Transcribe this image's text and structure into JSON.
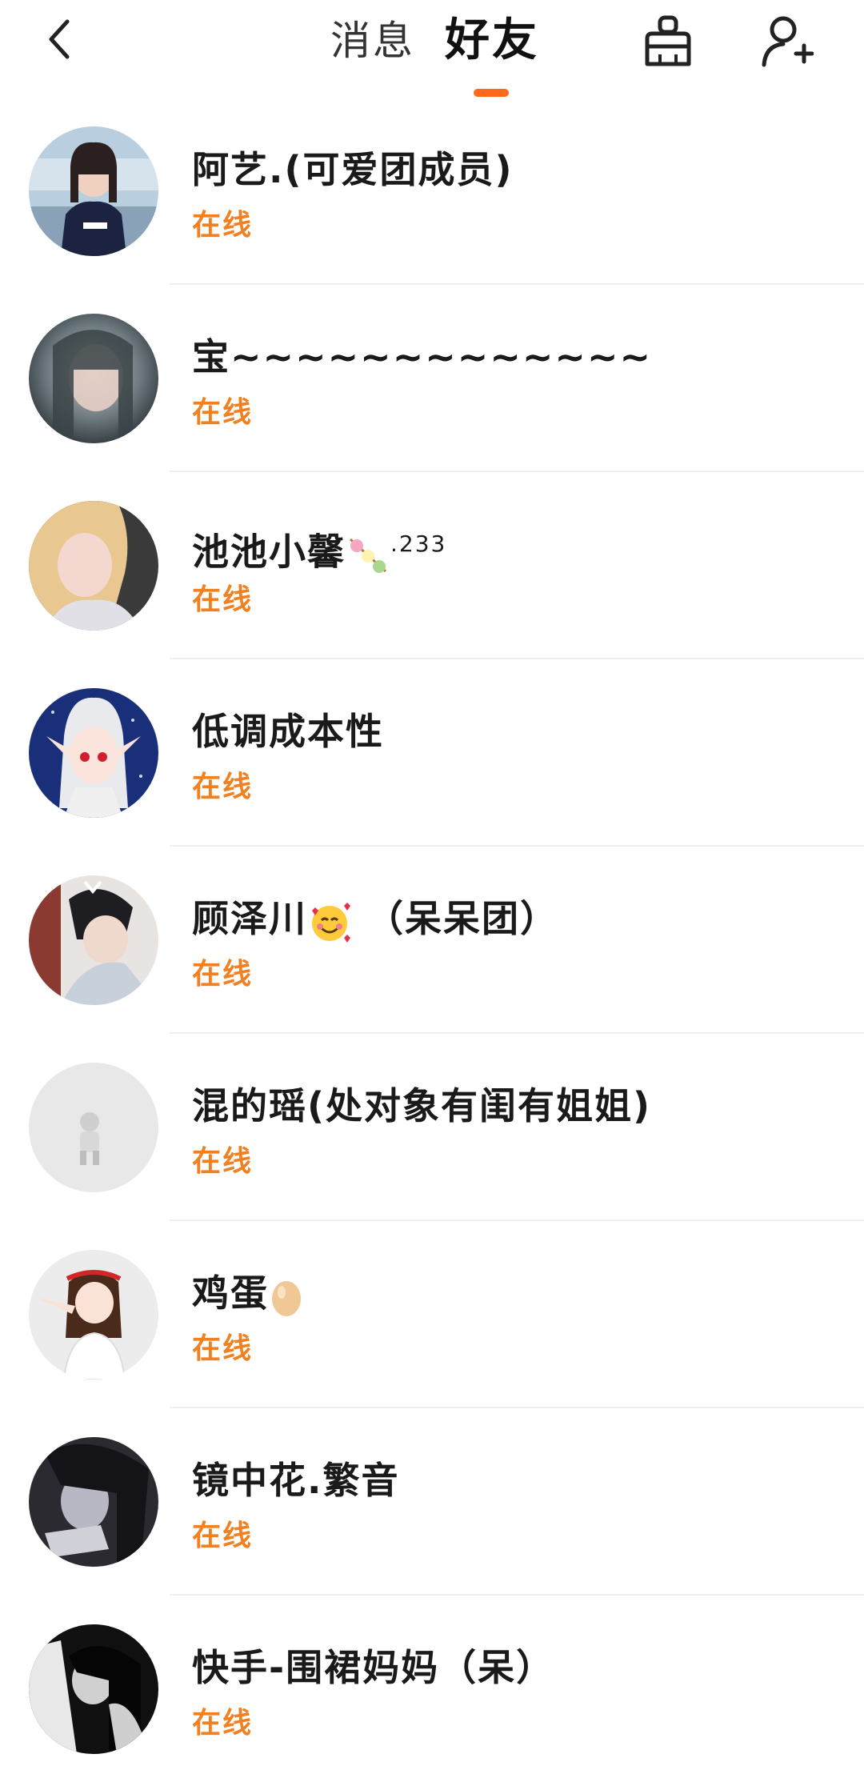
{
  "header": {
    "tab_messages": "消息",
    "tab_friends": "好友",
    "accent_color": "#ff6a1a"
  },
  "friends": [
    {
      "name": "阿艺.(可爱团成员)",
      "status": "在线",
      "avatar": "avatar-girl-jersey"
    },
    {
      "name": "宝~~~~~~~~~~~~~",
      "status": "在线",
      "avatar": "avatar-blurred-girl"
    },
    {
      "name": "池池小馨",
      "name_suffix": ".233",
      "status": "在线",
      "avatar": "avatar-blonde-girl"
    },
    {
      "name": "低调成本性",
      "status": "在线",
      "avatar": "avatar-anime-elf"
    },
    {
      "name": "顾泽川",
      "name_suffix": " （呆呆团）",
      "status": "在线",
      "avatar": "avatar-boy"
    },
    {
      "name": "混的瑶(处对象有闺有姐姐)",
      "status": "在线",
      "avatar": "avatar-figurine"
    },
    {
      "name": "鸡蛋",
      "status": "在线",
      "avatar": "avatar-anime-girl-salute"
    },
    {
      "name": "镜中花.繁音",
      "status": "在线",
      "avatar": "avatar-dark-portrait"
    },
    {
      "name": "快手-围裙妈妈（呆）",
      "status": "在线",
      "avatar": "avatar-bw-portrait"
    }
  ]
}
